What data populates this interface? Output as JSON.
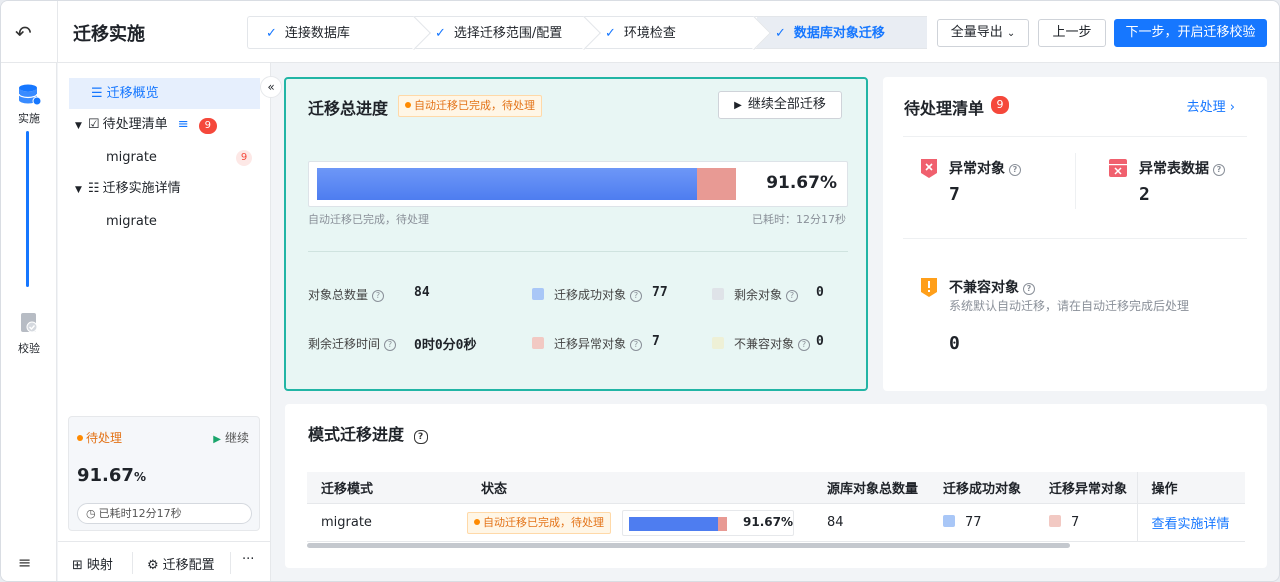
{
  "header": {
    "title": "迁移实施",
    "steps": [
      "连接数据库",
      "选择迁移范围/配置",
      "环境检查",
      "数据库对象迁移"
    ],
    "export_label": "全量导出",
    "prev_label": "上一步",
    "next_label": "下一步，开启迁移校验"
  },
  "rail": {
    "items": [
      {
        "label": "实施",
        "icon": "database-icon"
      },
      {
        "label": "校验",
        "icon": "verify-icon"
      }
    ]
  },
  "sidebar": {
    "overview_label": "迁移概览",
    "pending_label": "待处理清单",
    "pending_count": "9",
    "pending_child": "migrate",
    "pending_child_count": "9",
    "detail_label": "迁移实施详情",
    "detail_child": "migrate",
    "status": {
      "state": "待处理",
      "continue_label": "继续",
      "percent": "91.67",
      "percent_unit": "%",
      "elapsed": "已耗时12分17秒"
    },
    "footer": {
      "mapping_label": "映射",
      "config_label": "迁移配置",
      "more_label": "···"
    }
  },
  "progress": {
    "title": "迁移总进度",
    "status_tag": "自动迁移已完成，待处理",
    "continue_all_label": "继续全部迁移",
    "success_fraction": 0.8095,
    "error_fraction": 0.0833,
    "percent_text": "91.67%",
    "note_left": "自动迁移已完成，待处理",
    "note_right": "已耗时：12分17秒",
    "stats": {
      "total_label": "对象总数量",
      "total_value": "84",
      "success_label": "迁移成功对象",
      "success_value": "77",
      "remaining_label": "剩余对象",
      "remaining_value": "0",
      "time_label": "剩余迁移时间",
      "time_value": "0时0分0秒",
      "error_label": "迁移异常对象",
      "error_value": "7",
      "incompat_label": "不兼容对象",
      "incompat_value": "0"
    },
    "colors": {
      "success": "#a9c7f7",
      "error": "#f2c9c3",
      "remaining": "#dfe3e8",
      "incompat": "#eef0d6"
    }
  },
  "pending": {
    "title": "待处理清单",
    "count": "9",
    "go_label": "去处理",
    "abnormal_label": "异常对象",
    "abnormal_value": "7",
    "table_label": "异常表数据",
    "table_value": "2",
    "incompat_label": "不兼容对象",
    "incompat_desc": "系统默认自动迁移，请在自动迁移完成后处理",
    "incompat_value": "0"
  },
  "schema": {
    "title": "模式迁移进度",
    "columns": [
      "迁移模式",
      "状态",
      "源库对象总数量",
      "迁移成功对象",
      "迁移异常对象",
      "操作"
    ],
    "row": {
      "mode": "migrate",
      "status": "自动迁移已完成，待处理",
      "percent": "91.67%",
      "total": "84",
      "success": "77",
      "error": "7",
      "action": "查看实施详情"
    }
  }
}
